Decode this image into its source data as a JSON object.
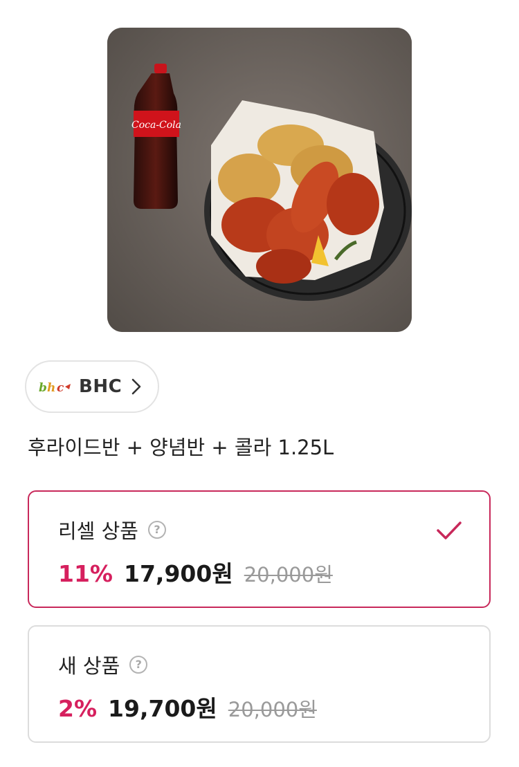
{
  "product": {
    "image_alt": "후라이드반 양념반 치킨과 콜라",
    "title": "후라이드반 + 양념반 + 콜라 1.25L"
  },
  "brand": {
    "logo_text": "bhc",
    "name": "BHC"
  },
  "options": [
    {
      "label": "리셀 상품",
      "discount": "11%",
      "price": "17,900원",
      "original_price": "20,000원",
      "selected": true
    },
    {
      "label": "새 상품",
      "discount": "2%",
      "price": "19,700원",
      "original_price": "20,000원",
      "selected": false
    }
  ],
  "colors": {
    "accent": "#d6205e",
    "selected_border": "#c8285a",
    "card_border": "#dcdcdc",
    "strike_text": "#9a9a9a"
  },
  "icons": {
    "help": "question-circle-icon",
    "check": "check-icon",
    "chevron": "chevron-right-icon"
  }
}
